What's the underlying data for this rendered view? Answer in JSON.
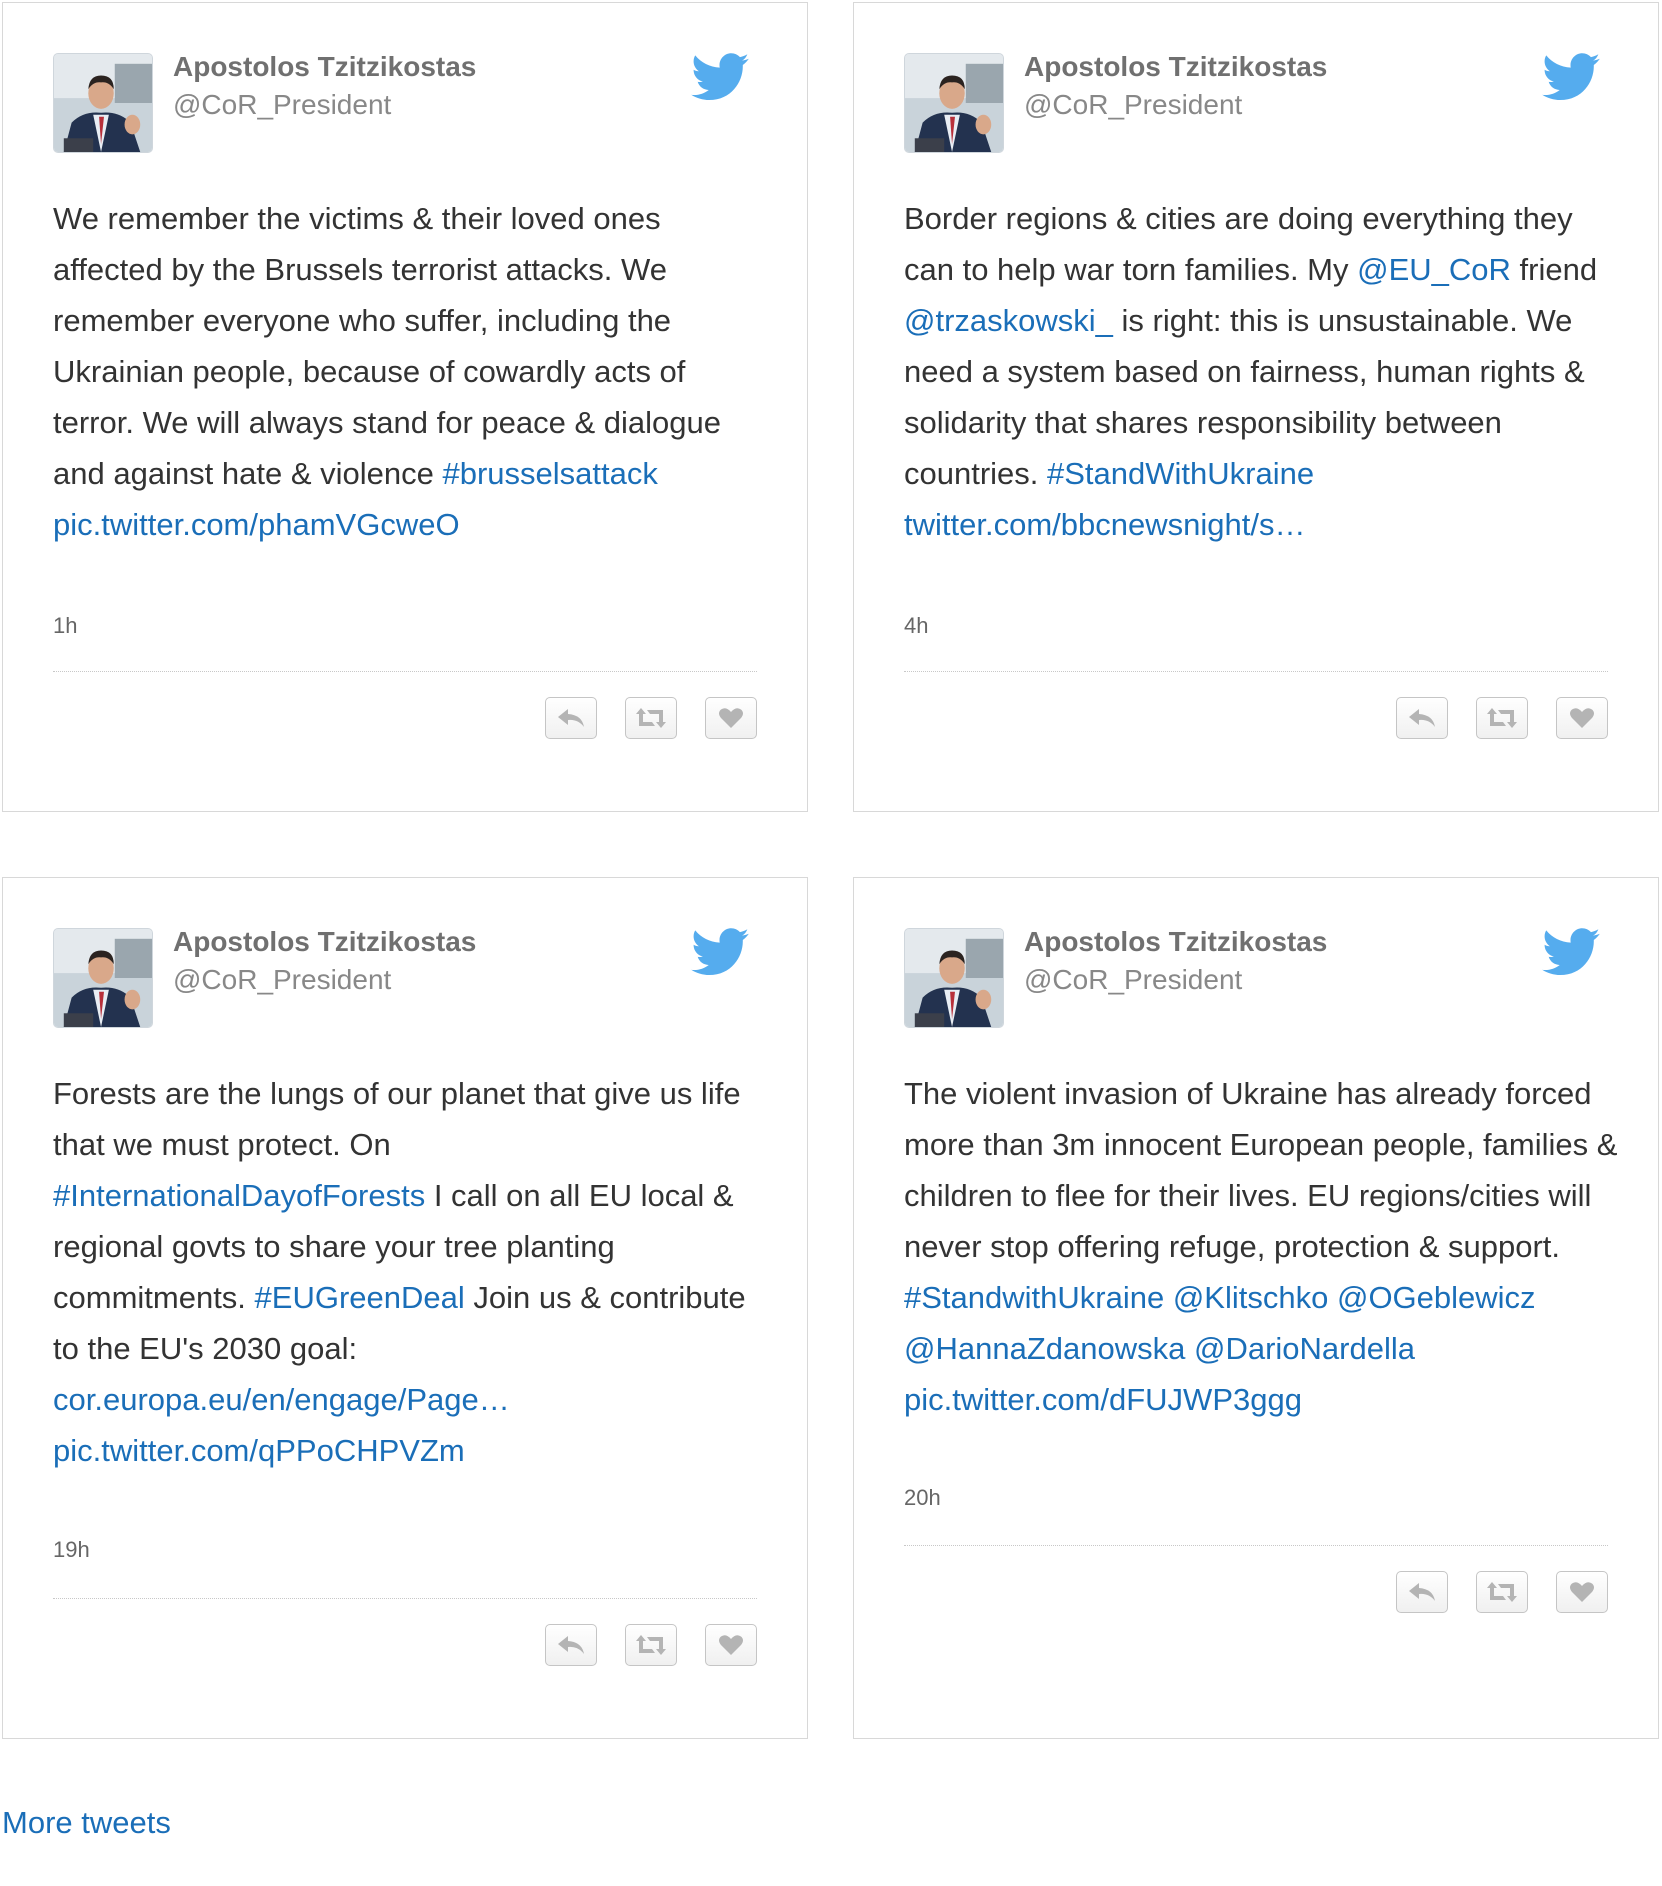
{
  "colors": {
    "link": "#1a6eb8",
    "text": "#333333",
    "muted": "#888888",
    "bird": "#55acee",
    "border": "#d8d8d8"
  },
  "icons": {
    "brand": "twitter-bird-icon",
    "reply": "reply-icon",
    "retweet": "retweet-icon",
    "like": "heart-icon",
    "avatar": "profile-photo"
  },
  "tweets": [
    {
      "author_name": "Apostolos Tzitzikostas",
      "author_handle": "@CoR_President",
      "time": "1h",
      "segments": [
        {
          "t": "We remember the victims & their loved ones affected by the Brussels terrorist attacks. We remember everyone who suffer, including the Ukrainian people, because of cowardly acts of terror. We will always stand for peace & dialogue and against hate & violence "
        },
        {
          "t": "#brusselsattack",
          "link": true
        },
        {
          "t": " "
        },
        {
          "t": "pic.twitter.com/phamVGcweO",
          "link": true
        }
      ]
    },
    {
      "author_name": "Apostolos Tzitzikostas",
      "author_handle": "@CoR_President",
      "time": "4h",
      "segments": [
        {
          "t": "Border regions & cities are doing everything they can to help war torn families. My "
        },
        {
          "t": "@EU_CoR",
          "link": true
        },
        {
          "t": " friend "
        },
        {
          "t": "@trzaskowski_",
          "link": true
        },
        {
          "t": " is right: this is unsustainable. We need a system based on fairness, human rights & solidarity that shares responsibility between countries. "
        },
        {
          "t": "#StandWithUkraine",
          "link": true
        },
        {
          "t": " "
        },
        {
          "t": "twitter.com/bbcnewsnight/s…",
          "link": true
        }
      ]
    },
    {
      "author_name": "Apostolos Tzitzikostas",
      "author_handle": "@CoR_President",
      "time": "19h",
      "segments": [
        {
          "t": "Forests are the lungs of our planet that give us life that we must protect. On "
        },
        {
          "t": "#InternationalDayofForests",
          "link": true
        },
        {
          "t": " I call on all EU local & regional govts to share your tree planting commitments. "
        },
        {
          "t": "#EUGreenDeal",
          "link": true
        },
        {
          "t": " Join us & contribute to the EU's 2030 goal: "
        },
        {
          "t": "cor.europa.eu/en/engage/Page…",
          "link": true
        },
        {
          "t": " "
        },
        {
          "t": "pic.twitter.com/qPPoCHPVZm",
          "link": true
        }
      ]
    },
    {
      "author_name": "Apostolos Tzitzikostas",
      "author_handle": "@CoR_President",
      "time": "20h",
      "segments": [
        {
          "t": "The violent invasion of Ukraine has already forced more than 3m innocent European people, families & children to flee for their lives. EU regions/cities will never stop offering refuge, protection & support. "
        },
        {
          "t": "#StandwithUkraine",
          "link": true
        },
        {
          "t": " "
        },
        {
          "t": "@Klitschko",
          "link": true
        },
        {
          "t": " "
        },
        {
          "t": "@OGeblewicz",
          "link": true
        },
        {
          "t": " "
        },
        {
          "t": "@HannaZdanowska",
          "link": true
        },
        {
          "t": " "
        },
        {
          "t": "@DarioNardella",
          "link": true
        },
        {
          "t": " "
        },
        {
          "t": "pic.twitter.com/dFUJWP3ggg",
          "link": true
        }
      ]
    }
  ],
  "footer": {
    "more_tweets_label": "More tweets"
  }
}
